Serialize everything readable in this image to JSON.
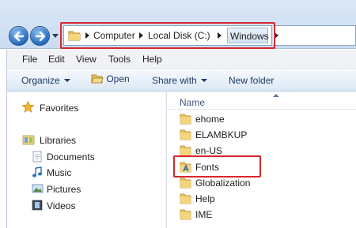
{
  "address_bar": {
    "crumbs": [
      "Computer",
      "Local Disk (C:)",
      "Windows"
    ]
  },
  "menu": [
    "File",
    "Edit",
    "View",
    "Tools",
    "Help"
  ],
  "command_bar": {
    "organize": "Organize",
    "open": "Open",
    "share_with": "Share with",
    "new_folder": "New folder"
  },
  "nav_pane": {
    "favorites": "Favorites",
    "libraries": "Libraries",
    "library_items": [
      "Documents",
      "Music",
      "Pictures",
      "Videos"
    ]
  },
  "file_list": {
    "column_name": "Name",
    "items": [
      "ehome",
      "ELAMBKUP",
      "en-US",
      "Fonts",
      "Globalization",
      "Help",
      "IME"
    ]
  },
  "colors": {
    "highlight": "#d7262f",
    "folder": "#e8c060",
    "window_bg": "#dbe8f6"
  }
}
